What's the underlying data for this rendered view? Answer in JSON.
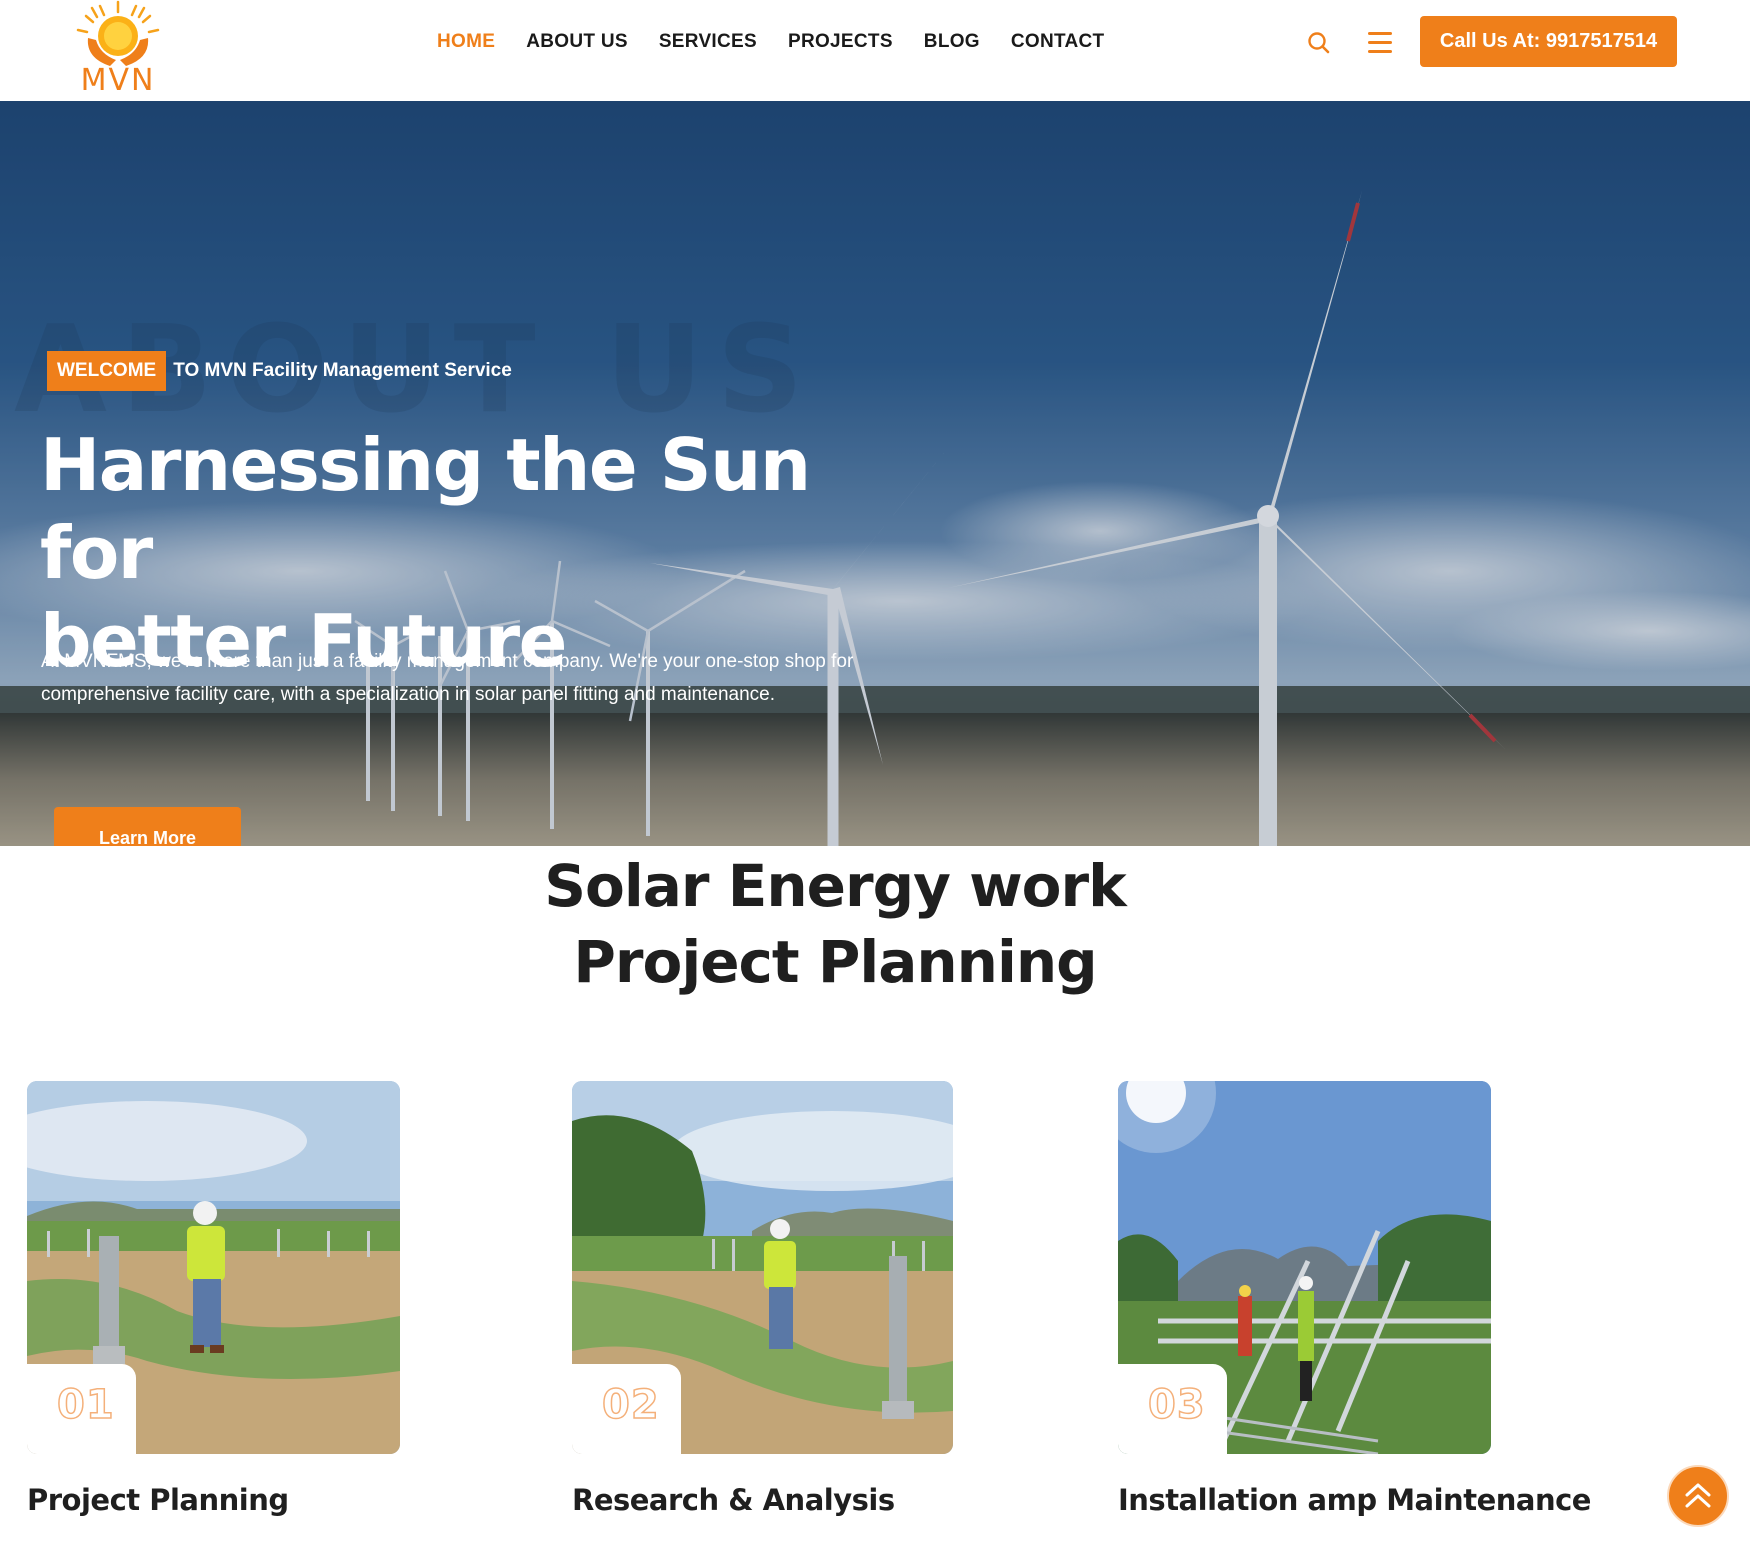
{
  "header": {
    "logo_text": "MVN",
    "nav": [
      {
        "label": "HOME",
        "active": true
      },
      {
        "label": "ABOUT US",
        "active": false
      },
      {
        "label": "SERVICES",
        "active": false
      },
      {
        "label": "PROJECTS",
        "active": false
      },
      {
        "label": "BLOG",
        "active": false
      },
      {
        "label": "CONTACT",
        "active": false
      }
    ],
    "call_label": "Call Us At: 9917517514",
    "icons": [
      "search-icon",
      "hamburger-menu-icon"
    ]
  },
  "hero": {
    "watermark": "ABOUT US",
    "welcome_badge": "WELCOME",
    "welcome_text": "TO MVN Facility Management Service",
    "title_line1": "Harnessing the Sun for",
    "title_line2": "better Future",
    "description": "At MVNFMS, we're more than just a facility management company. We're your one-stop shop for comprehensive facility care, with a specialization in solar panel fitting and maintenance.",
    "button_label": "Learn More"
  },
  "section": {
    "title_line1": "Solar Energy work",
    "title_line2": "Project Planning",
    "cards": [
      {
        "number": "01",
        "title": "Project Planning"
      },
      {
        "number": "02",
        "title": "Research & Analysis"
      },
      {
        "number": "03",
        "title": "Installation amp Maintenance"
      }
    ]
  },
  "colors": {
    "accent": "#ef7f1a",
    "text_dark": "#1f1f1f",
    "sky": "#264f7e"
  },
  "scroll_top_icon": "double-chevron-up-icon"
}
